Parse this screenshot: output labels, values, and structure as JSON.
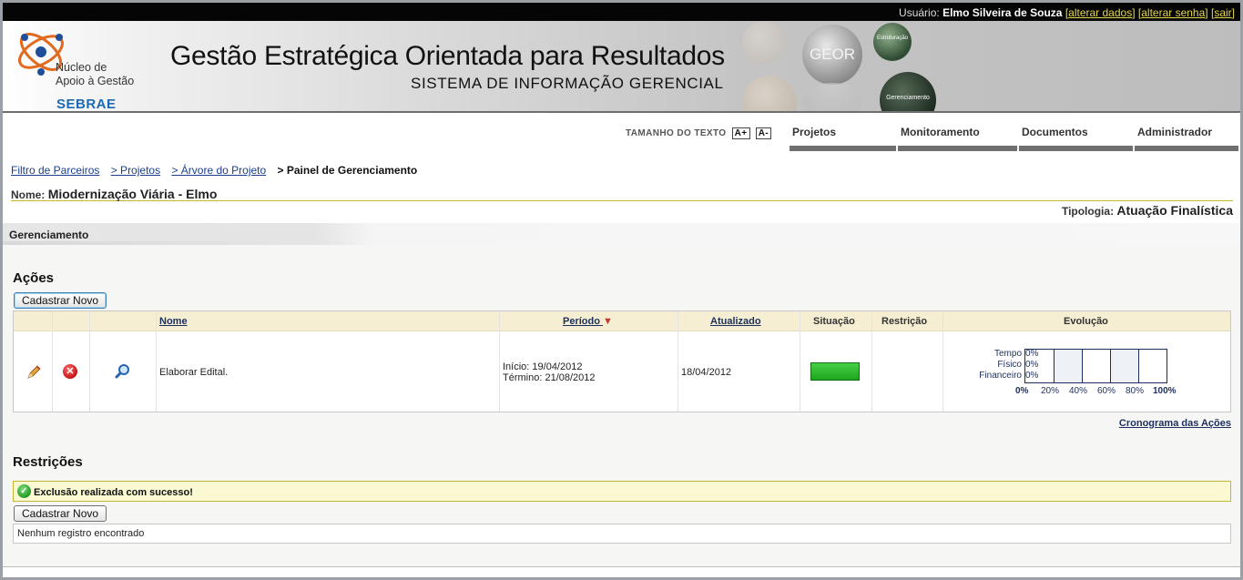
{
  "topbar": {
    "user_label": "Usuário:",
    "user_name": "Elmo Silveira de Souza",
    "links": [
      "alterar dados",
      "alterar senha",
      "sair"
    ]
  },
  "banner": {
    "logo_line1": "Núcleo de",
    "logo_line2": "Apoio à Gestão",
    "logo_brand": "SEBRAE",
    "title": "Gestão Estratégica Orientada para Resultados",
    "subtitle": "SISTEMA DE INFORMAÇÃO GERENCIAL",
    "ball_geor": "GEOR",
    "ball_estruturacao": "Estruturação",
    "ball_gerenciamento": "Gerenciamento"
  },
  "textsize": {
    "label": "TAMANHO DO TEXTO",
    "increase": "A+",
    "decrease": "A-"
  },
  "nav": [
    "Projetos",
    "Monitoramento",
    "Documentos",
    "Administrador"
  ],
  "breadcrumb": {
    "links": [
      "Filtro de Parceiros",
      "> Projetos",
      "> Árvore do Projeto"
    ],
    "current": "> Painel de Gerenciamento"
  },
  "project": {
    "name_label": "Nome:",
    "name": "Miodernização Viária - Elmo",
    "tipologia_label": "Tipologia:",
    "tipologia": "Atuação Finalística"
  },
  "panel": {
    "title": "Gerenciamento"
  },
  "acoes": {
    "title": "Ações",
    "new_button": "Cadastrar Novo",
    "columns": [
      "Nome",
      "Período",
      "Atualizado",
      "Situação",
      "Restrição",
      "Evolução"
    ],
    "sort_indicator": "▼",
    "rows": [
      {
        "nome": "Elaborar Edital.",
        "inicio": "Início: 19/04/2012",
        "termino": "Término: 21/08/2012",
        "atualizado": "18/04/2012",
        "situacao_color": "#1fa51f",
        "restricao": ""
      }
    ],
    "evolucao": {
      "labels": [
        "Tempo",
        "Físico",
        "Financeiro"
      ],
      "values": [
        "0%",
        "0%",
        "0%"
      ],
      "ticks": [
        "0%",
        "20%",
        "40%",
        "60%",
        "80%",
        "100%"
      ]
    },
    "cronograma_link": "Cronograma das Ações"
  },
  "restricoes": {
    "title": "Restrições",
    "message": "Exclusão realizada com sucesso!",
    "new_button": "Cadastrar Novo",
    "empty_text": "Nenhum registro encontrado"
  }
}
